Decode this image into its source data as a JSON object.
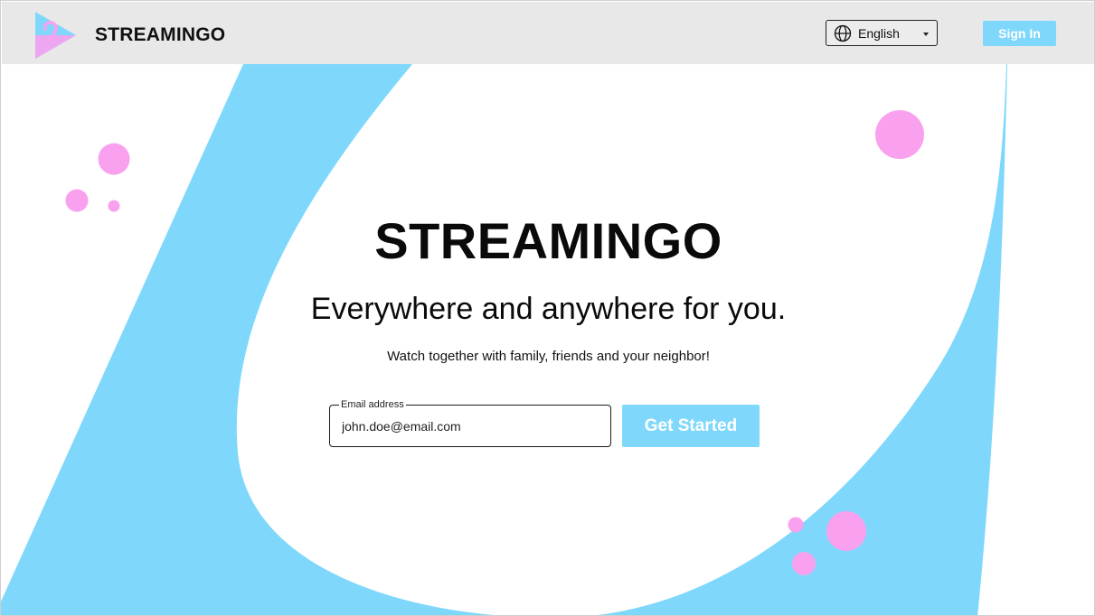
{
  "header": {
    "brand": "STREAMINGO",
    "language": {
      "selected": "English"
    },
    "sign_in_label": "Sign In"
  },
  "hero": {
    "title": "STREAMINGO",
    "subtitle": "Everywhere and anywhere for you.",
    "tagline": "Watch together with family, friends and your neighbor!",
    "email": {
      "label": "Email address",
      "value": "john.doe@email.com"
    },
    "cta_label": "Get Started"
  },
  "colors": {
    "accent_blue": "#7fd8fb",
    "accent_pink": "#f9a1ee",
    "header_bg": "#e8e8e8"
  },
  "icons": {
    "logo": "play-triangle-logo-icon",
    "language": "globe-icon",
    "dropdown": "caret-down-icon"
  }
}
